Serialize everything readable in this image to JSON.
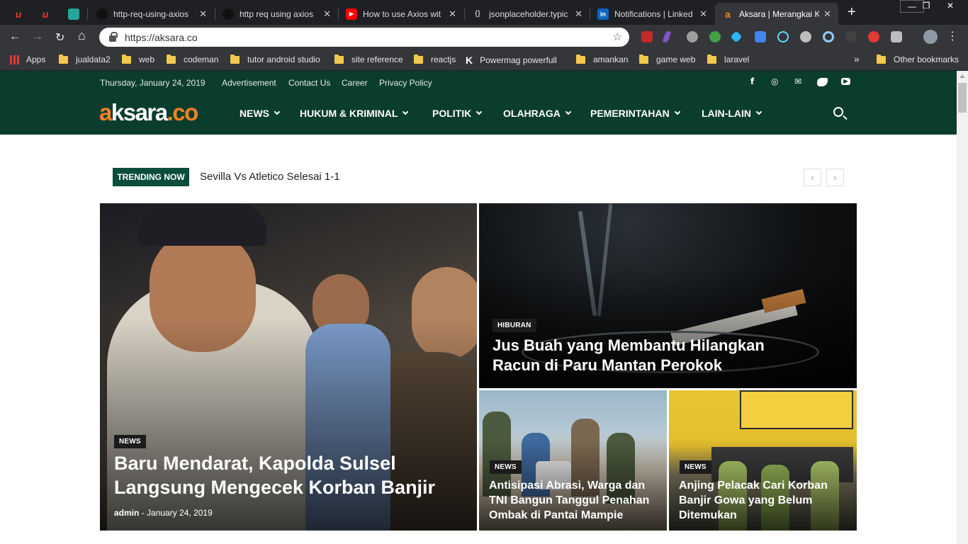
{
  "tabs": [
    {
      "title": "",
      "icon": "u",
      "color": "#e53935"
    },
    {
      "title": "",
      "icon": "u",
      "color": "#e53935"
    },
    {
      "title": "",
      "icon": "",
      "color": "#26a69a"
    },
    {
      "title": "http-req-using-axios",
      "icon": "gh",
      "color": "#333"
    },
    {
      "title": "http req using axios",
      "icon": "gh",
      "color": "#333"
    },
    {
      "title": "How to use Axios wit",
      "icon": "▶",
      "color": "#ff0000"
    },
    {
      "title": "jsonplaceholder.typic",
      "icon": "{}",
      "color": "#444"
    },
    {
      "title": "Notifications | Linked",
      "icon": "in",
      "color": "#0a66c2"
    },
    {
      "title": "Aksara | Merangkai K",
      "icon": "a",
      "color": "#f58220"
    }
  ],
  "window": {
    "minimize": "—",
    "restore": "❐",
    "close": "✕",
    "new_tab": "+"
  },
  "nav": {
    "back": "←",
    "forward": "→",
    "reload": "↻",
    "home": "⌂"
  },
  "address": {
    "url": "https://aksara.co",
    "star": "☆"
  },
  "bookmarks": {
    "apps": "Apps",
    "items": [
      "jualdata2",
      "web",
      "codeman",
      "tutor android studio",
      "site reference",
      "reactjs",
      "Powermag powerfull",
      "amankan",
      "game web",
      "laravel"
    ],
    "more": "»",
    "other": "Other bookmarks"
  },
  "site": {
    "date": "Thursday, January 24, 2019",
    "top_links": [
      "Advertisement",
      "Contact Us",
      "Career",
      "Privacy Policy"
    ],
    "social_icons": [
      "facebook-icon",
      "instagram-icon",
      "mail-icon",
      "twitter-icon",
      "youtube-icon"
    ],
    "social_glyphs": [
      "f",
      "◎",
      "✉",
      "🐦",
      "▶"
    ],
    "logo_a": "a",
    "logo_mid": "ksara",
    "logo_dot": ".co",
    "menu": [
      "NEWS",
      "HUKUM & KRIMINAL",
      "POLITIK",
      "OLAHRAGA",
      "PEMERINTAHAN",
      "LAIN-LAIN"
    ],
    "trending_label": "TRENDING NOW",
    "trending_text": "Sevilla Vs Atletico Selesai 1-1",
    "prev": "‹",
    "next": "›",
    "featured": {
      "category": "NEWS",
      "title": "Baru Mendarat, Kapolda Sulsel Langsung Mengecek Korban Banjir",
      "author": "admin",
      "sep": "-",
      "date": "January 24, 2019"
    },
    "side": {
      "category": "HIBURAN",
      "title": "Jus Buah yang Membantu Hilangkan Racun di Paru Mantan Perokok"
    },
    "small1": {
      "category": "NEWS",
      "title": "Antisipasi Abrasi, Warga dan TNI Bangun Tanggul Penahan Ombak di Pantai Mampie"
    },
    "small2": {
      "category": "NEWS",
      "title": "Anjing Pelacak Cari Korban Banjir Gowa yang Belum Ditemukan"
    }
  }
}
